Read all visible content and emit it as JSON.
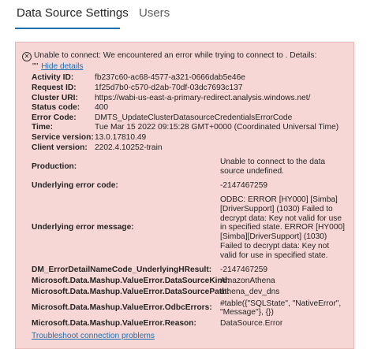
{
  "tabs": [
    {
      "label": "Data Source Settings",
      "active": true
    },
    {
      "label": "Users",
      "active": false
    }
  ],
  "error": {
    "message": "Unable to connect: We encountered an error while trying to connect to . Details:",
    "quote_text": "\"\"",
    "hide_details_label": "Hide details"
  },
  "details": [
    {
      "label": "Activity ID:",
      "value": "fb237c60-ac68-4577-a321-0666dab5e46e"
    },
    {
      "label": "Request ID:",
      "value": "1f25d7b0-c570-d2ab-70df-03dc7693c137"
    },
    {
      "label": "Cluster URI:",
      "value": "https://wabi-us-east-a-primary-redirect.analysis.windows.net/"
    },
    {
      "label": "Status code:",
      "value": "400"
    },
    {
      "label": "Error Code:",
      "value": "DMTS_UpdateClusterDatasourceCredentialsErrorCode"
    },
    {
      "label": "Time:",
      "value": "Tue Mar 15 2022 09:15:28 GMT+0000 (Coordinated Universal Time)"
    },
    {
      "label": "Service version:",
      "value": "13.0.17810.49"
    },
    {
      "label": "Client version:",
      "value": "2202.4.10252-train"
    }
  ],
  "extended": [
    {
      "label": "Production:",
      "value": "Unable to connect to the data source undefined."
    },
    {
      "label": "Underlying error code:",
      "value": "-2147467259"
    },
    {
      "label": "Underlying error message:",
      "value": "ODBC: ERROR [HY000] [Simba][DriverSupport] (1030) Failed to decrypt data: Key not valid for use in specified state. ERROR [HY000] [Simba][DriverSupport] (1030) Failed to decrypt data: Key not valid for use in specified state."
    },
    {
      "label": "DM_ErrorDetailNameCode_UnderlyingHResult:",
      "value": "-2147467259"
    },
    {
      "label": "Microsoft.Data.Mashup.ValueError.DataSourceKind:",
      "value": "AmazonAthena"
    },
    {
      "label": "Microsoft.Data.Mashup.ValueError.DataSourcePath:",
      "value": "athena_dev_dns"
    },
    {
      "label": "Microsoft.Data.Mashup.ValueError.OdbcErrors:",
      "value": "#table({\"SQLState\", \"NativeError\", \"Message\"}, {})"
    },
    {
      "label": "Microsoft.Data.Mashup.ValueError.Reason:",
      "value": "DataSource.Error"
    }
  ],
  "troubleshoot_label": "Troubleshoot connection problems"
}
